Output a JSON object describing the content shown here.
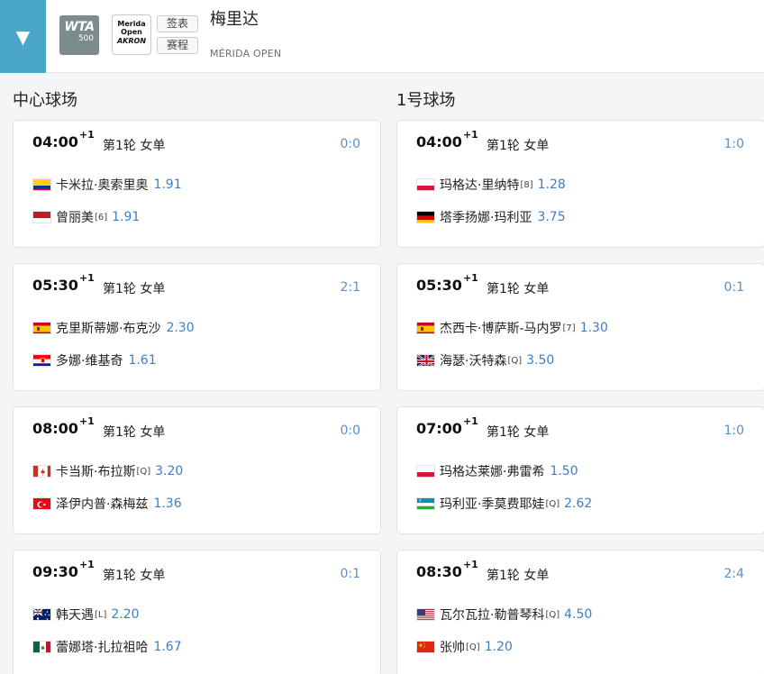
{
  "header": {
    "toggle_icon": "▼",
    "wta_logo_line1": "WTA",
    "wta_logo_line2": "500",
    "event_logo": [
      "Merida",
      "Open",
      "AKRON"
    ],
    "draw_label": "签表",
    "schedule_label": "赛程",
    "title": "梅里达",
    "subtitle": "MÉRIDA OPEN"
  },
  "courts": [
    {
      "name": "中心球场",
      "matches": [
        {
          "time": "04:00",
          "plus": "+1",
          "round": "第1轮 女单",
          "score": "0:0",
          "p1": {
            "flag": "colombia-flag",
            "name": "卡米拉·奥索里奥",
            "seed": "",
            "odds": "1.91"
          },
          "p2": {
            "flag": "indonesia-flag",
            "name": "曾丽美",
            "seed": "[6]",
            "odds": "1.91"
          }
        },
        {
          "time": "05:30",
          "plus": "+1",
          "round": "第1轮 女单",
          "score": "2:1",
          "p1": {
            "flag": "spain-flag",
            "name": "克里斯蒂娜·布克沙",
            "seed": "",
            "odds": "2.30"
          },
          "p2": {
            "flag": "croatia-flag",
            "name": "多娜·维基奇",
            "seed": "",
            "odds": "1.61"
          }
        },
        {
          "time": "08:00",
          "plus": "+1",
          "round": "第1轮 女单",
          "score": "0:0",
          "p1": {
            "flag": "canada-flag",
            "name": "卡当斯·布拉斯",
            "seed": "[Q]",
            "odds": "3.20"
          },
          "p2": {
            "flag": "turkey-flag",
            "name": "泽伊内普·森梅兹",
            "seed": "",
            "odds": "1.36"
          }
        },
        {
          "time": "09:30",
          "plus": "+1",
          "round": "第1轮 女单",
          "score": "0:1",
          "p1": {
            "flag": "australia-flag",
            "name": "韩天遇",
            "seed": "[L]",
            "odds": "2.20"
          },
          "p2": {
            "flag": "mexico-flag",
            "name": "蕾娜塔·扎拉祖哈",
            "seed": "",
            "odds": "1.67"
          }
        }
      ]
    },
    {
      "name": "1号球场",
      "matches": [
        {
          "time": "04:00",
          "plus": "+1",
          "round": "第1轮 女单",
          "score": "1:0",
          "p1": {
            "flag": "poland-flag",
            "name": "玛格达·里纳特",
            "seed": "[8]",
            "odds": "1.28"
          },
          "p2": {
            "flag": "germany-flag",
            "name": "塔季扬娜·玛利亚",
            "seed": "",
            "odds": "3.75"
          }
        },
        {
          "time": "05:30",
          "plus": "+1",
          "round": "第1轮 女单",
          "score": "0:1",
          "p1": {
            "flag": "spain-flag",
            "name": "杰西卡·博萨斯-马内罗",
            "seed": "[7]",
            "odds": "1.30"
          },
          "p2": {
            "flag": "uk-flag",
            "name": "海瑟·沃特森",
            "seed": "[Q]",
            "odds": "3.50"
          }
        },
        {
          "time": "07:00",
          "plus": "+1",
          "round": "第1轮 女单",
          "score": "1:0",
          "p1": {
            "flag": "poland-flag",
            "name": "玛格达莱娜·弗雷希",
            "seed": "",
            "odds": "1.50"
          },
          "p2": {
            "flag": "uzbekistan-flag",
            "name": "玛利亚·季莫费耶娃",
            "seed": "[Q]",
            "odds": "2.62"
          }
        },
        {
          "time": "08:30",
          "plus": "+1",
          "round": "第1轮 女单",
          "score": "2:4",
          "p1": {
            "flag": "usa-flag",
            "name": "瓦尔瓦拉·勒普琴科",
            "seed": "[Q]",
            "odds": "4.50"
          },
          "p2": {
            "flag": "china-flag",
            "name": "张帅",
            "seed": "[Q]",
            "odds": "1.20"
          }
        }
      ]
    }
  ]
}
